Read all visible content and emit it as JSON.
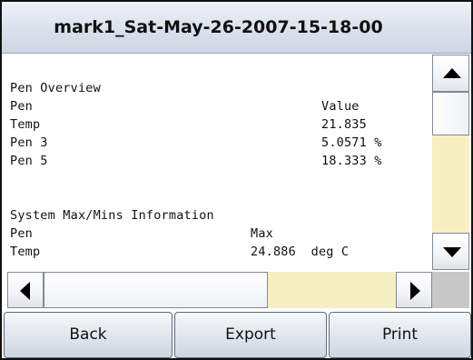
{
  "window": {
    "title": "mark1_Sat-May-26-2007-15-18-00"
  },
  "report": {
    "lines": [
      {
        "c1": "Pen Overview",
        "c2": "",
        "c3": ""
      },
      {
        "c1": "Pen",
        "c2": "Value",
        "c3": ""
      },
      {
        "c1": "Temp",
        "c2": "21.835",
        "c3": ""
      },
      {
        "c1": "Pen 3",
        "c2": "5.0571 %",
        "c3": ""
      },
      {
        "c1": "Pen 5",
        "c2": "18.333 %",
        "c3": ""
      },
      {
        "c1": "",
        "c2": "",
        "c3": ""
      },
      {
        "c1": "",
        "c2": "",
        "c3": ""
      },
      {
        "c1": "System Max/Mins Information",
        "c2": "",
        "c3": ""
      },
      {
        "c1": "Pen",
        "c2": "",
        "c3": "Max"
      },
      {
        "c1": "Temp",
        "c2": "",
        "c3": "24.886  deg C"
      }
    ]
  },
  "buttons": {
    "back": "Back",
    "export": "Export",
    "print": "Print"
  },
  "colors": {
    "scroll_track": "#f6efc2",
    "titlebar": "#d9e1ec"
  }
}
